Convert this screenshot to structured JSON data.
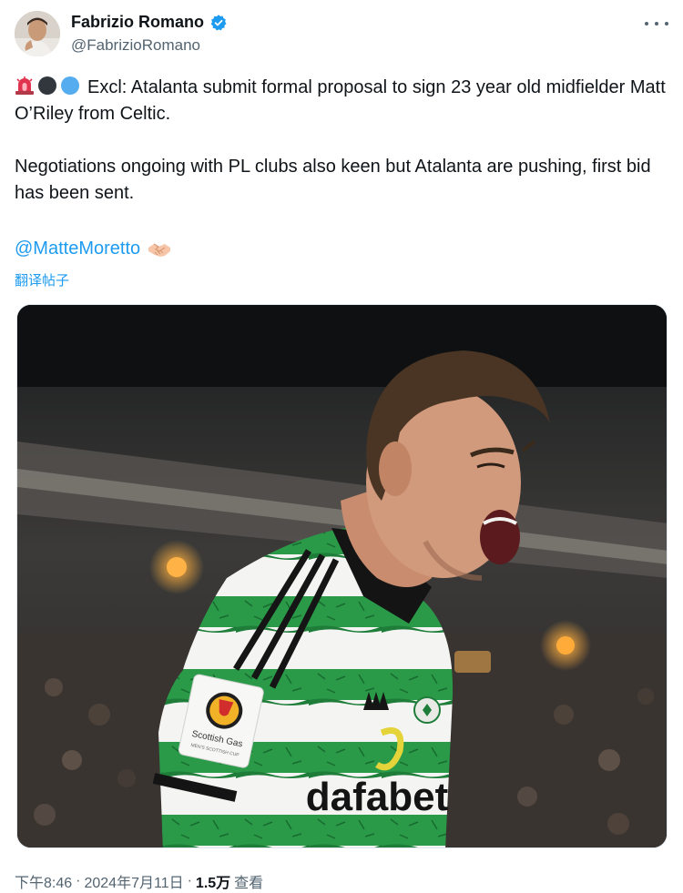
{
  "author": {
    "display_name": "Fabrizio Romano",
    "handle": "@FabrizioRomano"
  },
  "tweet": {
    "paragraph_1": "Excl: Atalanta submit formal proposal to sign 23 year old midfielder Matt O’Riley from Celtic.",
    "paragraph_2": "Negotiations ongoing with PL clubs also keen but Atalanta are pushing, first bid has been sent.",
    "mention": "@MatteMoretto",
    "translate_label": "翻译帖子",
    "emojis": [
      "siren-emoji",
      "black-circle-emoji",
      "blue-circle-emoji",
      "handshake-emoji"
    ]
  },
  "media": {
    "shirt_sponsor": "dafabet",
    "sleeve_badge_text": "Scottish Gas",
    "sleeve_badge_sub": "MEN'S SCOTTISH CUP"
  },
  "meta": {
    "time": "下午8:46",
    "sep1": "·",
    "date": "2024年7月11日",
    "sep2": "·",
    "views_count": "1.5万",
    "views_label": "查看"
  },
  "colors": {
    "link": "#1d9bf0",
    "secondary_text": "#536471",
    "verified": "#1d9bf0",
    "celtic_green": "#1f8f3e"
  }
}
